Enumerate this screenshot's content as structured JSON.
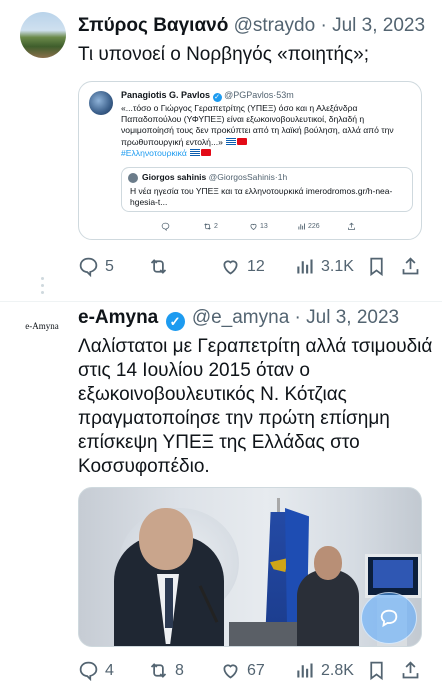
{
  "tweet1": {
    "name": "Σπύρος Βαγιανό",
    "handle": "@straydo",
    "date": "Jul 3, 2023",
    "more": "···",
    "text": "Τι υπονοεί ο Νορβηγός «ποιητής»;",
    "quote": {
      "name": "Panagiotis G. Pavlos",
      "handle": "@PGPavlos",
      "time": "53m",
      "text": "«...τόσο ο Γιώργος Γεραπετρίτης (ΥΠΕΞ) όσο και η Αλεξάνδρα Παπαδοπούλου (ΥΦΥΠΕΞ) είναι εξωκοινοβουλευτικοί, δηλαδή η νομιμοποίησή τους δεν προκύπτει από τη λαϊκή βούληση, αλλά από την πρωθυπουργική εντολή...»",
      "hashtag": "#Ελληνοτουρκικά",
      "inner": {
        "name": "Giorgos sahinis",
        "handle": "@GiorgosSahinis",
        "time": "1h",
        "text": "Η νέα ηγεσία του ΥΠΕΞ και τα ελληνοτουρκικά imerodromos.gr/h-nea-hgesia-t..."
      },
      "actions": {
        "retweets": "2",
        "likes": "13",
        "views": "226"
      }
    },
    "actions": {
      "replies": "5",
      "retweets": "",
      "likes": "12",
      "views": "3.1K"
    }
  },
  "tweet2": {
    "avatar_text": "e-Amyna",
    "name": "e-Amyna",
    "handle": "@e_amyna",
    "date": "Jul 3, 2023",
    "text": "Λαλίστατοι με Γεραπετρίτη αλλά τσιμουδιά στις 14 Ιουλίου 2015 όταν ο εξωκοινοβουλευτικός Ν. Κότζιας πραγματοποίησε την πρώτη επίσημη επίσκεψη ΥΠΕΞ της Ελλάδας στο Κοσσυφοπέδιο.",
    "actions": {
      "replies": "4",
      "retweets": "8",
      "likes": "67",
      "views": "2.8K"
    }
  },
  "colors": {
    "accent": "#1d9bf0",
    "muted": "#536471",
    "border": "#cfd9de",
    "text": "#0f1419"
  },
  "icons": [
    "reply-icon",
    "retweet-icon",
    "like-icon",
    "views-icon",
    "bookmark-icon",
    "share-icon",
    "verified-icon",
    "chat-bubble-icon"
  ]
}
